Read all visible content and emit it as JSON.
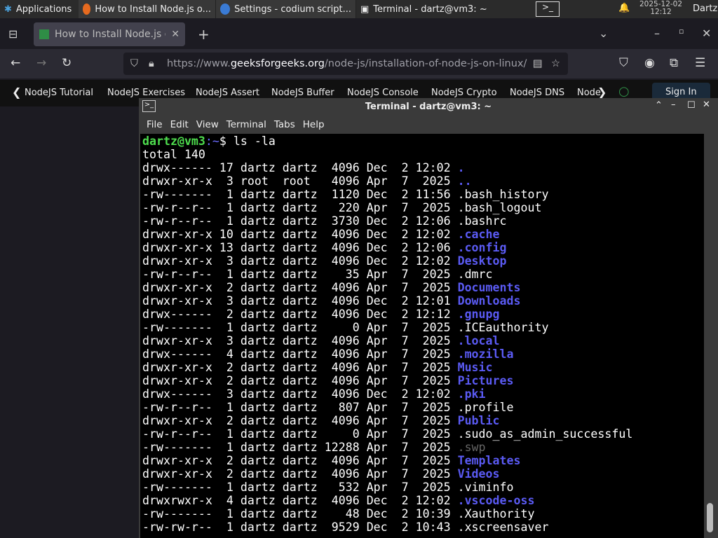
{
  "taskbar": {
    "applications": "Applications",
    "windows": [
      "How to Install Node.js o...",
      "Settings - codium script...",
      "Terminal - dartz@vm3: ~"
    ],
    "date": "2025-12-02",
    "time": "12:12",
    "user": "Dartz"
  },
  "browser": {
    "tab_title": "How to Install Node.js or",
    "url_scheme": "https://www.",
    "url_domain": "geeksforgeeks.org",
    "url_path": "/node-js/installation-of-node-js-on-linux/",
    "bookmarks": [
      "NodeJS Tutorial",
      "NodeJS Exercises",
      "NodeJS Assert",
      "NodeJS Buffer",
      "NodeJS Console",
      "NodeJS Crypto",
      "NodeJS DNS",
      "Node"
    ],
    "sign_in": "Sign In"
  },
  "terminal": {
    "title": "Terminal - dartz@vm3: ~",
    "menu": [
      "File",
      "Edit",
      "View",
      "Terminal",
      "Tabs",
      "Help"
    ],
    "prompt_user": "dartz@vm3",
    "prompt_path": ":~",
    "prompt_sign": "$ ",
    "command": "ls -la",
    "total": "total 140",
    "rows": [
      [
        "drwx------ 17 dartz dartz  4096 Dec  2 12:02 ",
        ".",
        "dir"
      ],
      [
        "drwxr-xr-x  3 root  root   4096 Apr  7  2025 ",
        "..",
        "dir"
      ],
      [
        "-rw-------  1 dartz dartz  1120 Dec  2 11:56 ",
        ".bash_history",
        "file"
      ],
      [
        "-rw-r--r--  1 dartz dartz   220 Apr  7  2025 ",
        ".bash_logout",
        "file"
      ],
      [
        "-rw-r--r--  1 dartz dartz  3730 Dec  2 12:06 ",
        ".bashrc",
        "file"
      ],
      [
        "drwxr-xr-x 10 dartz dartz  4096 Dec  2 12:02 ",
        ".cache",
        "dir"
      ],
      [
        "drwxr-xr-x 13 dartz dartz  4096 Dec  2 12:06 ",
        ".config",
        "dir"
      ],
      [
        "drwxr-xr-x  3 dartz dartz  4096 Dec  2 12:02 ",
        "Desktop",
        "dir"
      ],
      [
        "-rw-r--r--  1 dartz dartz    35 Apr  7  2025 ",
        ".dmrc",
        "file"
      ],
      [
        "drwxr-xr-x  2 dartz dartz  4096 Apr  7  2025 ",
        "Documents",
        "dir"
      ],
      [
        "drwxr-xr-x  3 dartz dartz  4096 Dec  2 12:01 ",
        "Downloads",
        "dir"
      ],
      [
        "drwx------  2 dartz dartz  4096 Dec  2 12:12 ",
        ".gnupg",
        "dir"
      ],
      [
        "-rw-------  1 dartz dartz     0 Apr  7  2025 ",
        ".ICEauthority",
        "file"
      ],
      [
        "drwxr-xr-x  3 dartz dartz  4096 Apr  7  2025 ",
        ".local",
        "dir"
      ],
      [
        "drwx------  4 dartz dartz  4096 Apr  7  2025 ",
        ".mozilla",
        "dir"
      ],
      [
        "drwxr-xr-x  2 dartz dartz  4096 Apr  7  2025 ",
        "Music",
        "dir"
      ],
      [
        "drwxr-xr-x  2 dartz dartz  4096 Apr  7  2025 ",
        "Pictures",
        "dir"
      ],
      [
        "drwx------  3 dartz dartz  4096 Dec  2 12:02 ",
        ".pki",
        "dir"
      ],
      [
        "-rw-r--r--  1 dartz dartz   807 Apr  7  2025 ",
        ".profile",
        "file"
      ],
      [
        "drwxr-xr-x  2 dartz dartz  4096 Apr  7  2025 ",
        "Public",
        "dir"
      ],
      [
        "-rw-r--r--  1 dartz dartz     0 Apr  7  2025 ",
        ".sudo_as_admin_successful",
        "file"
      ],
      [
        "-rw-------  1 dartz dartz 12288 Apr  7  2025 ",
        ".swp",
        "hidden"
      ],
      [
        "drwxr-xr-x  2 dartz dartz  4096 Apr  7  2025 ",
        "Templates",
        "dir"
      ],
      [
        "drwxr-xr-x  2 dartz dartz  4096 Apr  7  2025 ",
        "Videos",
        "dir"
      ],
      [
        "-rw-------  1 dartz dartz   532 Apr  7  2025 ",
        ".viminfo",
        "file"
      ],
      [
        "drwxrwxr-x  4 dartz dartz  4096 Dec  2 12:02 ",
        ".vscode-oss",
        "dir"
      ],
      [
        "-rw-------  1 dartz dartz    48 Dec  2 10:39 ",
        ".Xauthority",
        "file"
      ],
      [
        "-rw-rw-r--  1 dartz dartz  9529 Dec  2 10:43 ",
        ".xscreensaver",
        "file"
      ]
    ]
  },
  "colors": {
    "prompt": "#4ede4e",
    "directory": "#5b5bf5",
    "terminal_bg": "#000000"
  }
}
